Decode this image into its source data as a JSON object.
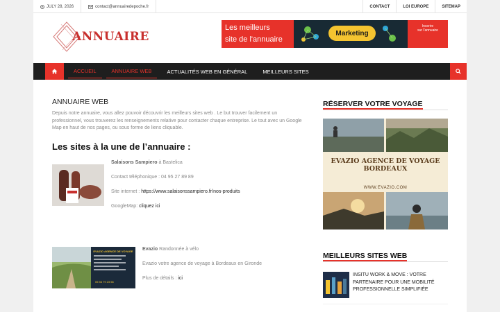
{
  "topbar": {
    "date": "JULY 28, 2026",
    "email": "contact@annuairedepoche.fr",
    "links": [
      "CONTACT",
      "LOI EUROPE",
      "SITEMAP"
    ]
  },
  "header": {
    "logo_text": "ANNUAIRE",
    "banner": {
      "line1": "Les meilleurs",
      "line2": "site de l'annuaire",
      "badge": "Marketing",
      "side_line1": "Inscrire",
      "side_line2": "sur l'annuaire"
    }
  },
  "nav": {
    "items": [
      "ACCUEIL",
      "ANNUAIRE WEB",
      "ACTUALITÉS WEB EN GÉNÉRAL",
      "MEILLEURS SITES"
    ]
  },
  "main": {
    "title": "ANNUAIRE WEB",
    "intro": "Depuis notre annuaire, vous allez pouvoir découvrir les meilleurs sites web . Le but trouver facilement un professionnel, vous trouverez les renseignements relative pour contacter chaque entreprise. Le tout avec un Google Map en haut de nos pages, ou sous forme de liens cliquable.",
    "section_title": "Les sites à la une de l’annuaire :",
    "entries": [
      {
        "name": "Salaisons Sampiero",
        "location": " à Bastelica",
        "phone": "Contact téléphonique : 04 95 27 89 89",
        "site_label": "Site internet : ",
        "site_link": "https://www.salaisonssampiero.fr/nos-produits",
        "map_label": "GoogleMap: ",
        "map_link": "cliquez ici"
      },
      {
        "name": "Evazio",
        "location": " Randonnée à vélo",
        "desc": "Evazio votre agence de voyage à Bordeaux en Gironde",
        "more_label": "Plus de détails : ",
        "more_link": "ici",
        "img_title": "EVAZIO AGENCE DE VOYAGE",
        "img_phone": "05 56 79 23 56"
      }
    ]
  },
  "sidebar": {
    "travel_heading": "RÉSERVER VOTRE VOYAGE",
    "travel_ad_title": "EVAZIO AGENCE DE VOYAGE BORDEAUX",
    "travel_ad_url": "WWW.EVAZIO.COM",
    "best_heading": "MEILLEURS SITES WEB",
    "best_item": "INSITU WORK & MOVE : VOTRE PARTENAIRE POUR UNE MOBILITÉ PROFESSIONNELLE SIMPLIFIÉE"
  },
  "colors": {
    "accent": "#e7322a",
    "nav_bg": "#1e1e1e",
    "ad_brown": "#5b3c1c"
  }
}
